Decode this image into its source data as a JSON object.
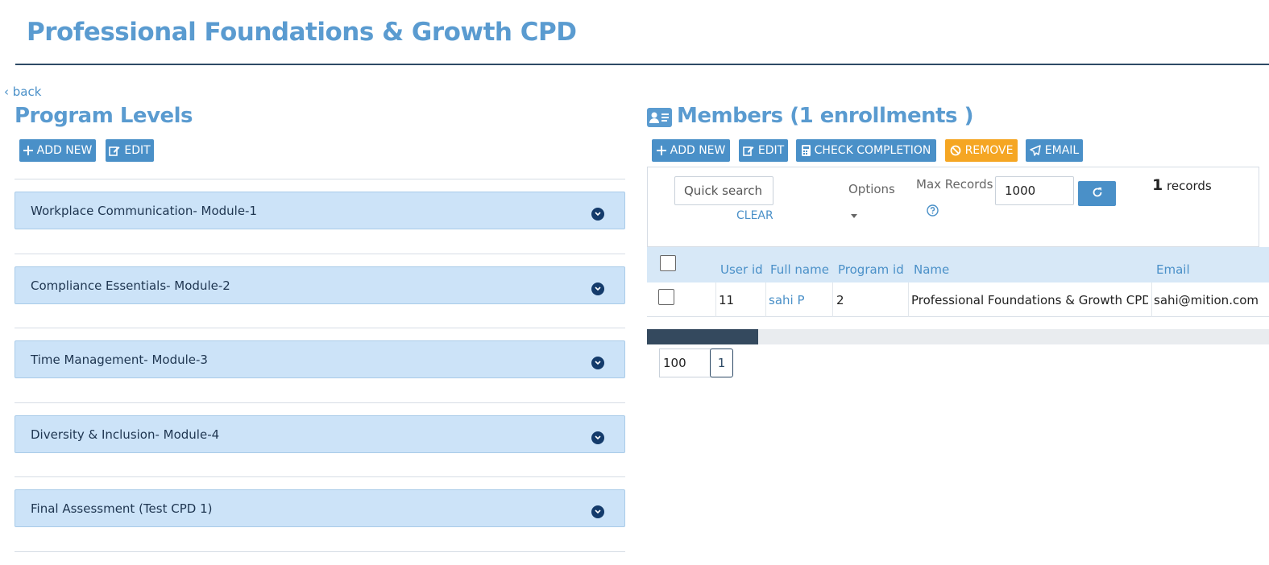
{
  "page": {
    "title": "Professional Foundations & Growth CPD",
    "back_label": "back"
  },
  "program_levels": {
    "title": "Program Levels",
    "add_new_label": "ADD NEW",
    "edit_label": "EDIT",
    "modules": [
      {
        "label": "Workplace Communication- Module-1"
      },
      {
        "label": "Compliance Essentials- Module-2"
      },
      {
        "label": "Time Management- Module-3"
      },
      {
        "label": "Diversity & Inclusion- Module-4"
      },
      {
        "label": "Final Assessment (Test CPD 1)"
      }
    ]
  },
  "members": {
    "title": "Members (1 enrollments )",
    "toolbar": {
      "add_new_label": "ADD NEW",
      "edit_label": "EDIT",
      "check_completion_label": "CHECK COMPLETION",
      "remove_label": "REMOVE",
      "email_label": "EMAIL"
    },
    "filters": {
      "quick_search_placeholder": "Quick search",
      "clear_label": "CLEAR",
      "options_label": "Options",
      "max_records_label": "Max Records",
      "max_records_value": "1000",
      "record_count": "1",
      "records_suffix": "records"
    },
    "table": {
      "columns": [
        "User id",
        "Full name",
        "Program id",
        "Name",
        "Email"
      ],
      "rows": [
        {
          "user_id": "11",
          "full_name": "sahi P",
          "program_id": "2",
          "name": "Professional Foundations & Growth CPD",
          "email": "sahi@mition.com"
        }
      ]
    },
    "pagination": {
      "page_size": "100",
      "current_page": "1"
    }
  },
  "colors": {
    "accent": "#4a90c8",
    "title": "#5a9bd0",
    "accordion_bg": "#cce3f8",
    "remove": "#f5a623",
    "chevron": "#143b6b"
  },
  "icons": {
    "add": "plus-icon",
    "edit": "edit-icon",
    "check_completion": "calculator-icon",
    "remove": "ban-icon",
    "email": "paper-plane-icon",
    "members": "id-card-icon",
    "refresh": "refresh-icon",
    "help": "question-circle-icon",
    "expand": "chevron-down-icon"
  }
}
